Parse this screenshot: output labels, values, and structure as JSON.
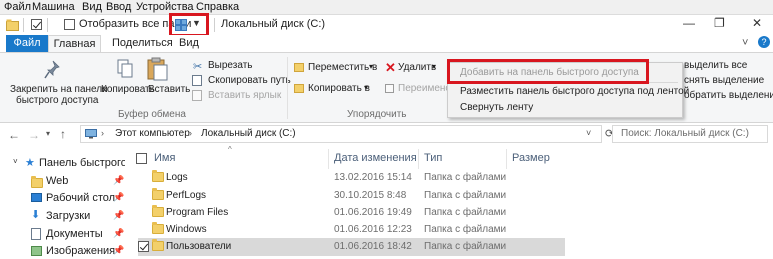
{
  "vm_menu": [
    "Файл",
    "Машина",
    "Вид",
    "Ввод",
    "Устройства",
    "Справка"
  ],
  "titlebar": {
    "qa_item_label": "Отобразить все папки",
    "title": "Локальный диск (C:)",
    "minimize": "—",
    "maximize": "❐",
    "close": "✕",
    "collapse": "˅",
    "help": "?"
  },
  "tabs": [
    "Файл",
    "Главная",
    "Поделиться",
    "Вид"
  ],
  "ribbon": {
    "pin_line1": "Закрепить на панели",
    "pin_line2": "быстрого доступа",
    "copy": "Копировать",
    "paste": "Вставить",
    "cut": "Вырезать",
    "copy_path": "Скопировать путь",
    "paste_shortcut": "Вставить ярлык",
    "clipboard_group": "Буфер обмена",
    "move_to": "Переместить в",
    "copy_to": "Копировать в",
    "delete": "Удалить",
    "rename": "Переименовать",
    "organize_group": "Упорядочить",
    "select_all": "выделить все",
    "deselect": "снять выделение",
    "invert": "обратить выделение"
  },
  "context_menu": {
    "items": [
      "Добавить на панель быстрого доступа",
      "Разместить панель быстрого доступа под лентой",
      "Свернуть ленту"
    ]
  },
  "address": {
    "path": [
      "Этот компьютер",
      "Локальный диск (C:)"
    ],
    "refresh": "⟳",
    "search_placeholder": "Поиск: Локальный диск (C:)"
  },
  "nav_pane": {
    "items": [
      "Панель быстрого доступа",
      "Web",
      "Рабочий стол",
      "Загрузки",
      "Документы",
      "Изображения"
    ]
  },
  "file_list": {
    "columns": [
      "Имя",
      "Дата изменения",
      "Тип",
      "Размер"
    ],
    "rows": [
      {
        "name": "Logs",
        "date": "13.02.2016 15:14",
        "type": "Папка с файлами"
      },
      {
        "name": "PerfLogs",
        "date": "30.10.2015 8:48",
        "type": "Папка с файлами"
      },
      {
        "name": "Program Files",
        "date": "01.06.2016 19:49",
        "type": "Папка с файлами"
      },
      {
        "name": "Windows",
        "date": "01.06.2016 12:23",
        "type": "Папка с файлами"
      },
      {
        "name": "Пользователи",
        "date": "01.06.2016 18:42",
        "type": "Папка с файлами"
      }
    ]
  },
  "colors": {
    "file_tab": "#1979ca",
    "highlight": "#d8161f",
    "selected_row": "#d9d9d9"
  }
}
